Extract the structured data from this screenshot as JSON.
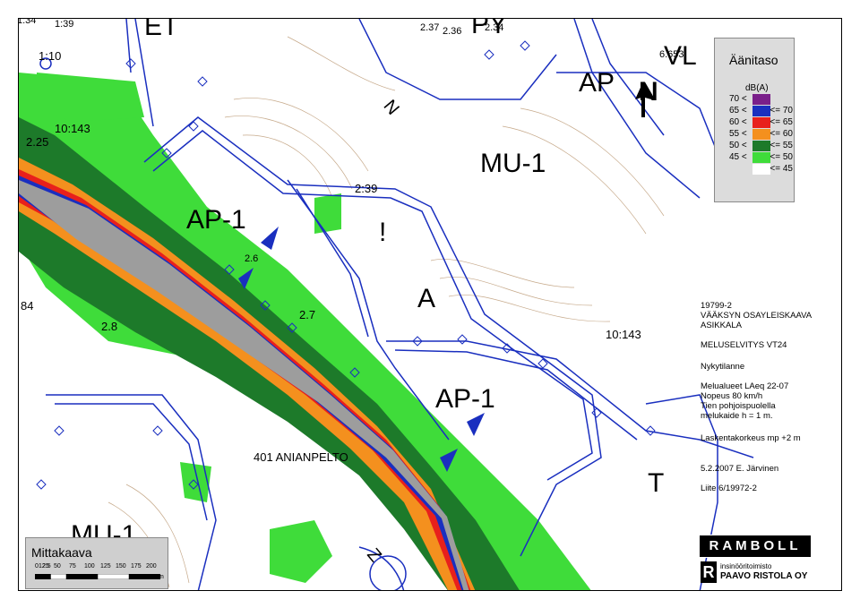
{
  "map": {
    "labels": {
      "et": "ET",
      "py": "PY",
      "ap_top": "AP",
      "vl": "VL",
      "mu1_top": "MU-1",
      "ap1_left": "AP-1",
      "a": "A",
      "ap1_right": "AP-1",
      "t": "T",
      "mu1_bottom": "MU-1",
      "road_name": "401 ANIANPELTO",
      "n_symbol": "N",
      "exclaim": "!",
      "z_label": "Z"
    },
    "numbers": {
      "n1": "1:34",
      "n2": "1:39",
      "n3": "1:10",
      "n4": "10:143",
      "n5": "2.25",
      "n6": "2:39",
      "n7": "2.8",
      "n8": "2.7",
      "n9": "2.6",
      "n10": "10:143",
      "n11": "84",
      "n12": "2.37",
      "n13": "2.36",
      "n14": "2.34",
      "n15": "6.653"
    }
  },
  "legend": {
    "title": "Äänitaso",
    "unit": "dB(A)",
    "rows": [
      {
        "lo": "70 <",
        "hi": "",
        "color": "#7a1f8a"
      },
      {
        "lo": "65 <",
        "hi": "<= 70",
        "color": "#1a2fbf"
      },
      {
        "lo": "60 <",
        "hi": "<= 65",
        "color": "#e8201c"
      },
      {
        "lo": "55 <",
        "hi": "<= 60",
        "color": "#f4901e"
      },
      {
        "lo": "50 <",
        "hi": "<= 55",
        "color": "#1d7a2a"
      },
      {
        "lo": "45 <",
        "hi": "<= 50",
        "color": "#3fdc3a"
      },
      {
        "lo": "",
        "hi": "<= 45",
        "color": "#ffffff"
      }
    ]
  },
  "info": {
    "code": "19799-2",
    "project_1": "VÄÄKSYN OSAYLEISKAAVA",
    "project_2": "ASIKKALA",
    "survey": "MELUSELVITYS VT24",
    "status": "Nykytilanne",
    "d1": "Melualueet LAeq 22-07",
    "d2": "Nopeus 80 km/h",
    "d3": "Tien pohjoispuolella",
    "d4": "melukaide h = 1 m.",
    "height": "Laskentakorkeus mp +2 m",
    "date": "5.2.2007 E. Järvinen",
    "appendix": "Liite 6/19972-2"
  },
  "logo": {
    "brand": "RAMBOLL",
    "mark": "R",
    "line1": "insinööritoimisto",
    "line2": "PAAVO RISTOLA OY"
  },
  "scale": {
    "title": "Mittakaava",
    "ticks": [
      "0",
      "12.5",
      "25",
      "50",
      "75",
      "100",
      "125",
      "150",
      "175",
      "200"
    ],
    "unit": "m"
  }
}
